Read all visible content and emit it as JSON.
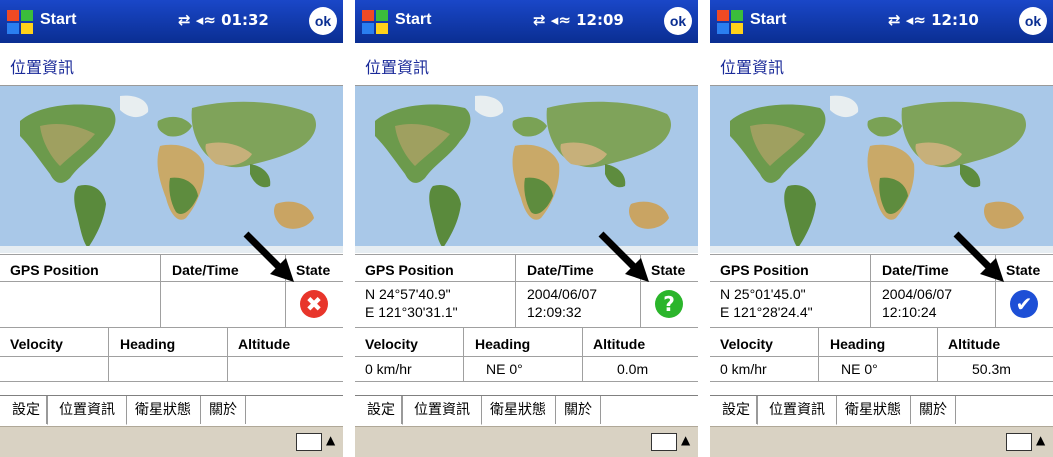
{
  "screens": [
    {
      "title": "Start",
      "status": "⇄ ◂≈ 01:32",
      "ok": "ok",
      "page_title": "位置資訊",
      "headers": {
        "pos": "GPS Position",
        "dt": "Date/Time",
        "state": "State",
        "vel": "Velocity",
        "head": "Heading",
        "alt": "Altitude"
      },
      "pos1": "",
      "pos2": "",
      "dt1": "",
      "dt2": "",
      "vel": "",
      "head": "",
      "alt": "",
      "state_symbol": "✖",
      "state_color": "#e8352b",
      "state_icon": "error-icon",
      "tabs": [
        "設定",
        "位置資訊",
        "衛星狀態",
        "關於"
      ]
    },
    {
      "title": "Start",
      "status": "⇄ ◂≈ 12:09",
      "ok": "ok",
      "page_title": "位置資訊",
      "headers": {
        "pos": "GPS Position",
        "dt": "Date/Time",
        "state": "State",
        "vel": "Velocity",
        "head": "Heading",
        "alt": "Altitude"
      },
      "pos1": "N  24°57'40.9\"",
      "pos2": "E 121°30'31.1\"",
      "dt1": "2004/06/07",
      "dt2": "12:09:32",
      "vel": "0 km/hr",
      "head": "NE 0°",
      "alt": "0.0m",
      "state_symbol": "?",
      "state_color": "#2bb52b",
      "state_icon": "question-icon",
      "tabs": [
        "設定",
        "位置資訊",
        "衛星狀態",
        "關於"
      ]
    },
    {
      "title": "Start",
      "status": "⇄ ◂≈ 12:10",
      "ok": "ok",
      "page_title": "位置資訊",
      "headers": {
        "pos": "GPS Position",
        "dt": "Date/Time",
        "state": "State",
        "vel": "Velocity",
        "head": "Heading",
        "alt": "Altitude"
      },
      "pos1": "N  25°01'45.0\"",
      "pos2": "E 121°28'24.4\"",
      "dt1": "2004/06/07",
      "dt2": "12:10:24",
      "vel": "0 km/hr",
      "head": "NE 0°",
      "alt": "50.3m",
      "state_symbol": "✔",
      "state_color": "#1d4fd6",
      "state_icon": "check-icon",
      "tabs": [
        "設定",
        "位置資訊",
        "衛星狀態",
        "關於"
      ]
    }
  ]
}
